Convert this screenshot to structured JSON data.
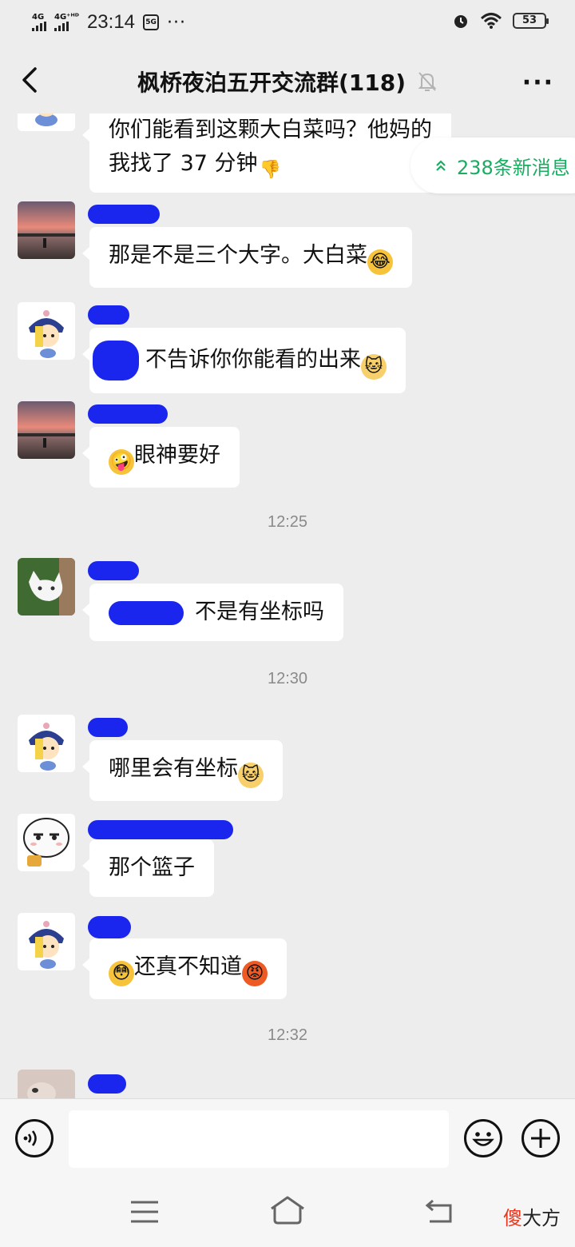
{
  "status_bar": {
    "net1": "4G",
    "net2": "4G⁺ᴴᴰ",
    "time": "23:14",
    "notif_badge": "5G",
    "dots": "···",
    "battery": "53"
  },
  "header": {
    "title": "枫桥夜泊五开交流群(118)",
    "back_icon": "chevron-left-icon",
    "mute_icon": "bell-off-icon",
    "more_label": "···"
  },
  "new_messages": {
    "label": "238条新消息",
    "icon": "double-chevron-up-icon",
    "color": "#1aad62"
  },
  "messages": [
    {
      "type": "text",
      "avatar": "cartoon-boy",
      "lines": [
        "你们能看到这颗大白菜吗？他妈的",
        "我找了 37 分钟"
      ],
      "emoji": "thumbs-down"
    },
    {
      "type": "text",
      "avatar": "sunset",
      "text": "那是不是三个大字。大白菜",
      "emoji": "laughing-face"
    },
    {
      "type": "text",
      "avatar": "cartoon-boy",
      "text": "不告诉你你能看的出来",
      "emoji": "cat-face"
    },
    {
      "type": "text",
      "avatar": "sunset",
      "text": "眼神要好",
      "emoji": "zany-face"
    },
    {
      "type": "time",
      "text": "12:25"
    },
    {
      "type": "text",
      "avatar": "white-cat",
      "text": "不是有坐标吗"
    },
    {
      "type": "time",
      "text": "12:30"
    },
    {
      "type": "text",
      "avatar": "cartoon-boy",
      "text": "哪里会有坐标",
      "emoji": "cat-face"
    },
    {
      "type": "text",
      "avatar": "meme-face",
      "text": "那个篮子"
    },
    {
      "type": "text",
      "avatar": "cartoon-boy",
      "text": "还真不知道",
      "emoji_before": "flushed-face",
      "emoji": "angry-face"
    },
    {
      "type": "time",
      "text": "12:32"
    }
  ],
  "input": {
    "placeholder": "",
    "voice_icon": "voice-icon",
    "emoji_icon": "smiley-icon",
    "plus_icon": "plus-icon"
  },
  "watermark": {
    "red_part": "傻",
    "rest": "大方"
  },
  "colors": {
    "background": "#ededed",
    "bubble": "#ffffff",
    "accent_green": "#1aad62",
    "redaction_blue": "#1a26ee"
  }
}
